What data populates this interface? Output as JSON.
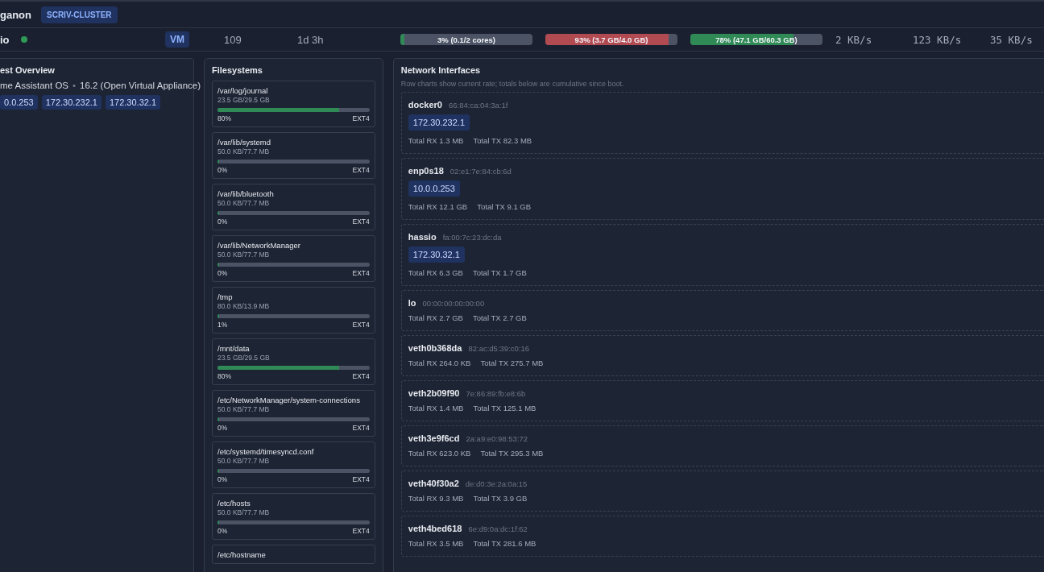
{
  "header": {
    "title": "ganon",
    "cluster_badge": "SCRIV-CLUSTER"
  },
  "guest_row": {
    "name": "io",
    "online": true,
    "type_badge": "VM",
    "id": "109",
    "uptime": "1d 3h",
    "meters": [
      {
        "label": "3% (0.1/2 cores)",
        "level": 0.03,
        "color": "#2f8a56"
      },
      {
        "label": "93% (3.7 GB/4.0 GB)",
        "level": 0.93,
        "color": "#b24a52"
      },
      {
        "label": "78% (47.1 GB/60.3 GB)",
        "level": 0.78,
        "color": "#2f8a56"
      }
    ],
    "rates": [
      "2 KB/s",
      "123 KB/s",
      "35 KB/s"
    ]
  },
  "guest_overview": {
    "title": "est Overview",
    "os": "me Assistant OS",
    "separator": "•",
    "version": "16.2 (Open Virtual Appliance)",
    "ips": [
      "0.0.253",
      "172.30.232.1",
      "172.30.32.1"
    ]
  },
  "filesystems": {
    "title": "Filesystems",
    "items": [
      {
        "path": "/var/log/journal",
        "usage": "23.5 GB/29.5 GB",
        "level": 0.8,
        "percent": "80%",
        "fs_type": "EXT4"
      },
      {
        "path": "/var/lib/systemd",
        "usage": "50.0 KB/77.7 MB",
        "level": 0,
        "percent": "0%",
        "fs_type": "EXT4"
      },
      {
        "path": "/var/lib/bluetooth",
        "usage": "50.0 KB/77.7 MB",
        "level": 0,
        "percent": "0%",
        "fs_type": "EXT4"
      },
      {
        "path": "/var/lib/NetworkManager",
        "usage": "50.0 KB/77.7 MB",
        "level": 0,
        "percent": "0%",
        "fs_type": "EXT4"
      },
      {
        "path": "/tmp",
        "usage": "80.0 KB/13.9 MB",
        "level": 0.01,
        "percent": "1%",
        "fs_type": "EXT4"
      },
      {
        "path": "/mnt/data",
        "usage": "23.5 GB/29.5 GB",
        "level": 0.8,
        "percent": "80%",
        "fs_type": "EXT4"
      },
      {
        "path": "/etc/NetworkManager/system-connections",
        "usage": "50.0 KB/77.7 MB",
        "level": 0,
        "percent": "0%",
        "fs_type": "EXT4"
      },
      {
        "path": "/etc/systemd/timesyncd.conf",
        "usage": "50.0 KB/77.7 MB",
        "level": 0,
        "percent": "0%",
        "fs_type": "EXT4"
      },
      {
        "path": "/etc/hosts",
        "usage": "50.0 KB/77.7 MB",
        "level": 0,
        "percent": "0%",
        "fs_type": "EXT4"
      },
      {
        "path": "/etc/hostname"
      }
    ]
  },
  "network": {
    "title": "Network Interfaces",
    "note": "Row charts show current rate; totals below are cumulative since boot.",
    "interfaces": [
      {
        "name": "docker0",
        "mac": "66:84:ca:04:3a:1f",
        "ips": [
          "172.30.232.1"
        ],
        "rx": "Total RX 1.3 MB",
        "tx": "Total TX 82.3 MB"
      },
      {
        "name": "enp0s18",
        "mac": "02:e1:7e:84:cb:6d",
        "ips": [
          "10.0.0.253"
        ],
        "rx": "Total RX 12.1 GB",
        "tx": "Total TX 9.1 GB"
      },
      {
        "name": "hassio",
        "mac": "fa:00:7c:23:dc:da",
        "ips": [
          "172.30.32.1"
        ],
        "rx": "Total RX 6.3 GB",
        "tx": "Total TX 1.7 GB"
      },
      {
        "name": "lo",
        "mac": "00:00:00:00:00:00",
        "rx": "Total RX 2.7 GB",
        "tx": "Total TX 2.7 GB"
      },
      {
        "name": "veth0b368da",
        "mac": "82:ac:d5:39:c0:16",
        "rx": "Total RX 264.0 KB",
        "tx": "Total TX 275.7 MB"
      },
      {
        "name": "veth2b09f90",
        "mac": "7e:86:89:fb:e8:6b",
        "rx": "Total RX 1.4 MB",
        "tx": "Total TX 125.1 MB"
      },
      {
        "name": "veth3e9f6cd",
        "mac": "2a:a9:e0:98:53:72",
        "rx": "Total RX 623.0 KB",
        "tx": "Total TX 295.3 MB"
      },
      {
        "name": "veth40f30a2",
        "mac": "de:d0:3e:2a:0a:15",
        "rx": "Total RX 9.3 MB",
        "tx": "Total TX 3.9 GB"
      },
      {
        "name": "veth4bed618",
        "mac": "6e:d9:0a:dc:1f:62",
        "rx": "Total RX 3.5 MB",
        "tx": "Total TX 281.6 MB"
      }
    ]
  }
}
